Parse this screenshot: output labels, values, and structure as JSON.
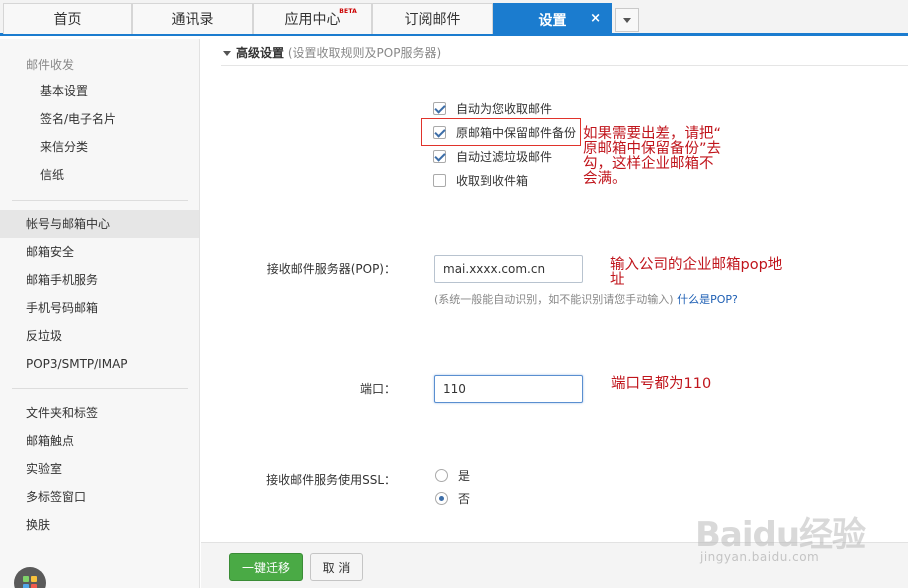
{
  "tabs": [
    {
      "label": "首页"
    },
    {
      "label": "通讯录"
    },
    {
      "label": "应用中心",
      "badge": "BETA"
    },
    {
      "label": "订阅邮件"
    },
    {
      "label": "设置",
      "close": "×"
    }
  ],
  "sidebar": {
    "group1_title": "邮件收发",
    "group1_items": [
      "基本设置",
      "签名/电子名片",
      "来信分类",
      "信纸"
    ],
    "group2_items": [
      "帐号与邮箱中心",
      "邮箱安全",
      "邮箱手机服务",
      "手机号码邮箱",
      "反垃圾",
      "POP3/SMTP/IMAP"
    ],
    "group3_items": [
      "文件夹和标签",
      "邮箱触点",
      "实验室",
      "多标签窗口",
      "换肤"
    ]
  },
  "section": {
    "title": "高级设置",
    "hint": "(设置收取规则及POP服务器)"
  },
  "options": [
    {
      "label": "自动为您收取邮件",
      "checked": true
    },
    {
      "label": "原邮箱中保留邮件备份",
      "checked": true
    },
    {
      "label": "自动过滤垃圾邮件",
      "checked": true
    },
    {
      "label": "收取到收件箱",
      "checked": false
    }
  ],
  "pop": {
    "label": "接收邮件服务器(POP)：",
    "value": "mai.xxxx.com.cn",
    "note": "(系统一般能自动识别，如不能识别请您手动输入)",
    "link": "什么是POP?"
  },
  "port": {
    "label": "端口：",
    "value": "110"
  },
  "ssl": {
    "label": "接收邮件服务使用SSL：",
    "options": [
      {
        "label": "是",
        "checked": false
      },
      {
        "label": "否",
        "checked": true
      }
    ]
  },
  "buttons": {
    "migrate": "一键迁移",
    "cancel": "取 消"
  },
  "annotations": {
    "backup_l1": "如果需要出差，请把“",
    "backup_l2": "原邮箱中保留备份”去",
    "backup_l3": "勾，这样企业邮箱不",
    "backup_l4": "会满。",
    "pop_l1": "输入公司的企业邮箱pop地",
    "pop_l2": "址",
    "port": "端口号都为110"
  },
  "watermark": {
    "main": "Baidu经验",
    "sub": "jingyan.baidu.com"
  },
  "colors": {
    "accent": "#1b7ccf",
    "annotation": "#c0151c",
    "primary_button": "#4aaa45"
  }
}
